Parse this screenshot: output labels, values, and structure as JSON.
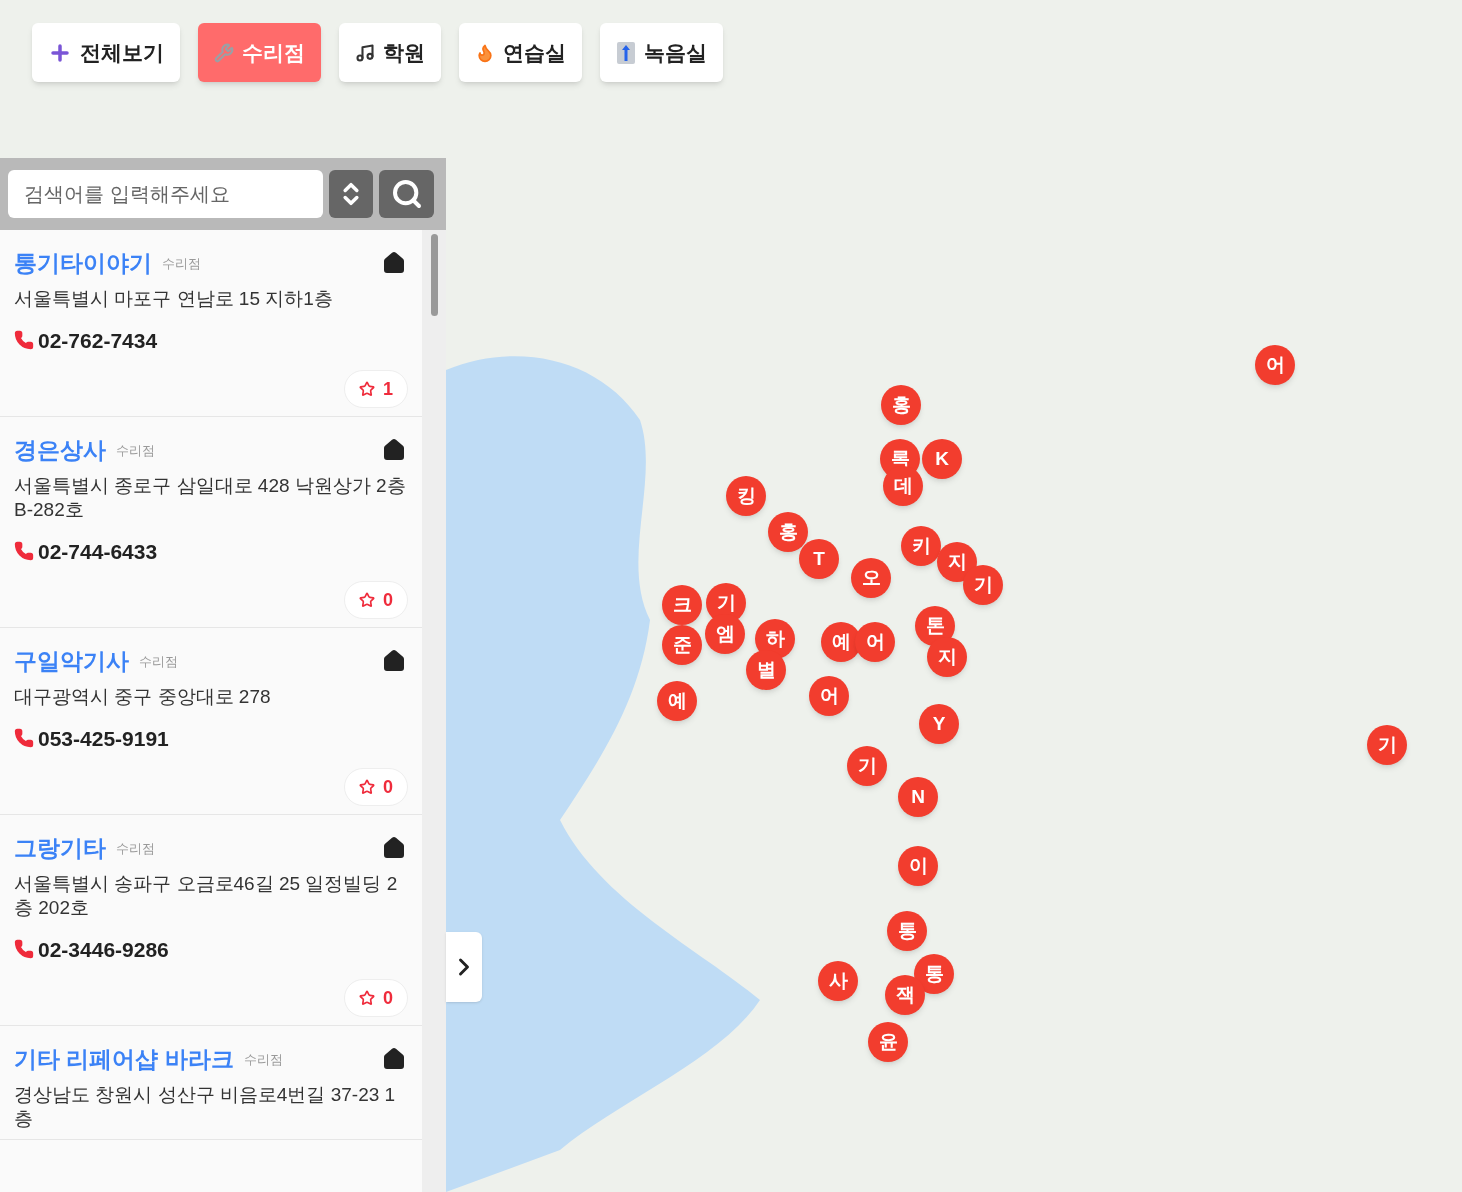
{
  "filters": [
    {
      "label": "전체보기",
      "kind": "all",
      "selected": false
    },
    {
      "label": "수리점",
      "kind": "repair",
      "selected": true
    },
    {
      "label": "학원",
      "kind": "academy",
      "selected": false
    },
    {
      "label": "연습실",
      "kind": "practice",
      "selected": false
    },
    {
      "label": "녹음실",
      "kind": "recording",
      "selected": false
    }
  ],
  "search": {
    "placeholder": "검색어를 입력해주세요"
  },
  "places": [
    {
      "name": "통기타이야기",
      "category": "수리점",
      "address": "서울특별시 마포구 연남로 15 지하1층",
      "phone": "02-762-7434",
      "likes": "1"
    },
    {
      "name": "경은상사",
      "category": "수리점",
      "address": "서울특별시 종로구 삼일대로 428 낙원상가 2층 B-282호",
      "phone": "02-744-6433",
      "likes": "0"
    },
    {
      "name": "구일악기사",
      "category": "수리점",
      "address": "대구광역시 중구 중앙대로 278",
      "phone": "053-425-9191",
      "likes": "0"
    },
    {
      "name": "그랑기타",
      "category": "수리점",
      "address": "서울특별시 송파구 오금로46길 25 일정빌딩 2층 202호",
      "phone": "02-3446-9286",
      "likes": "0"
    },
    {
      "name": "기타 리페어샵 바라크",
      "category": "수리점",
      "address": "경상남도 창원시 성산구 비음로4번길 37-23 1층"
    }
  ],
  "markers": [
    {
      "label": "홍"
    },
    {
      "label": "록"
    },
    {
      "label": "K"
    },
    {
      "label": "데"
    },
    {
      "label": "킹"
    },
    {
      "label": "홍"
    },
    {
      "label": "키"
    },
    {
      "label": "지"
    },
    {
      "label": "T"
    },
    {
      "label": "오"
    },
    {
      "label": "기"
    },
    {
      "label": "크"
    },
    {
      "label": "기"
    },
    {
      "label": "톤"
    },
    {
      "label": "준"
    },
    {
      "label": "엠"
    },
    {
      "label": "하"
    },
    {
      "label": "예"
    },
    {
      "label": "어"
    },
    {
      "label": "별"
    },
    {
      "label": "지"
    },
    {
      "label": "예"
    },
    {
      "label": "어"
    },
    {
      "label": "Y"
    },
    {
      "label": "기"
    },
    {
      "label": "N"
    },
    {
      "label": "이"
    },
    {
      "label": "통"
    },
    {
      "label": "통"
    },
    {
      "label": "사"
    },
    {
      "label": "잭"
    },
    {
      "label": "윤"
    },
    {
      "label": "어"
    },
    {
      "label": "기"
    }
  ]
}
